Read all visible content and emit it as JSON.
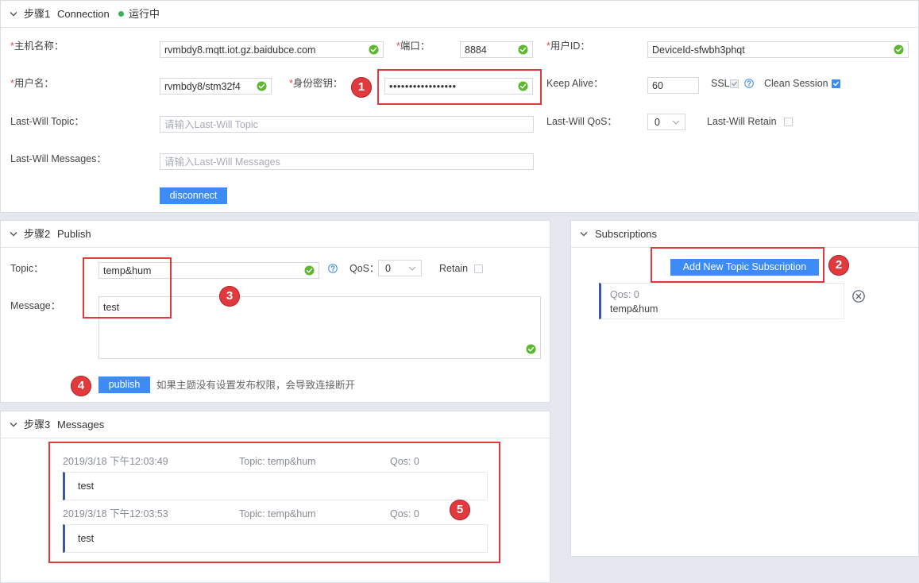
{
  "theme": {
    "accent": "#3d8cf5",
    "status_color": "#33b35a",
    "valid_color": "#5cb82e",
    "annotation_color": "#e0393e",
    "card_accent": "#3956a9",
    "required_color": "#e84545"
  },
  "icons": {
    "collapse": "chevron-down-icon",
    "valid": "check-circle-icon",
    "help": "help-icon",
    "dropdown": "chevron-down-icon",
    "remove": "close-circle-icon",
    "checkbox_checked": "checkmark-icon"
  },
  "connection": {
    "step": "步骤1",
    "title": "Connection",
    "status": "运行中",
    "required_mark": "*",
    "host": {
      "label": "主机名称：",
      "value": "rvmbdy8.mqtt.iot.gz.baidubce.com"
    },
    "port": {
      "label": "端口：",
      "value": "8884"
    },
    "user_id": {
      "label": "用户ID：",
      "value": "DeviceId-sfwbh3phqt"
    },
    "username": {
      "label": "用户名：",
      "value": "rvmbdy8/stm32f4"
    },
    "secret": {
      "label": "身份密钥：",
      "value": "•••••••••••••••••"
    },
    "keep_alive": {
      "label": "Keep Alive：",
      "value": "60"
    },
    "ssl": {
      "label": "SSL",
      "checked": true,
      "disabled": true
    },
    "clean_session": {
      "label": "Clean Session",
      "checked": true
    },
    "last_will_topic": {
      "label": "Last-Will Topic：",
      "placeholder": "请输入Last-Will Topic"
    },
    "last_will_qos": {
      "label": "Last-Will QoS：",
      "value": "0"
    },
    "last_will_retain": {
      "label": "Last-Will Retain",
      "checked": false
    },
    "last_will_messages": {
      "label": "Last-Will Messages：",
      "placeholder": "请输入Last-Will Messages"
    },
    "disconnect_label": "disconnect"
  },
  "publish": {
    "step": "步骤2",
    "title": "Publish",
    "topic": {
      "label": "Topic：",
      "value": "temp&hum"
    },
    "qos": {
      "label": "QoS：",
      "value": "0"
    },
    "retain": {
      "label": "Retain",
      "checked": false
    },
    "message": {
      "label": "Message：",
      "value": "test"
    },
    "publish_label": "publish",
    "hint": "如果主题没有设置发布权限，会导致连接断开"
  },
  "subscriptions": {
    "title": "Subscriptions",
    "add_label": "Add New Topic Subscription",
    "items": [
      {
        "qos": "Qos: 0",
        "topic": "temp&hum"
      }
    ]
  },
  "messages": {
    "step": "步骤3",
    "title": "Messages",
    "items": [
      {
        "time": "2019/3/18 下午12:03:49",
        "topic": "Topic: temp&hum",
        "qos": "Qos: 0",
        "payload": "test"
      },
      {
        "time": "2019/3/18 下午12:03:53",
        "topic": "Topic: temp&hum",
        "qos": "Qos: 0",
        "payload": "test"
      }
    ]
  },
  "annotations": [
    "1",
    "2",
    "3",
    "4",
    "5"
  ]
}
